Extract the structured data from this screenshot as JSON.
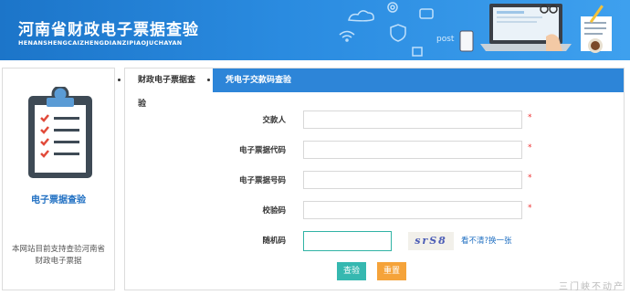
{
  "header": {
    "title": "河南省财政电子票据查验",
    "subtitle": "HENANSHENGCAIZHENGDIANZIPIAOJUCHAYAN",
    "deco_word": "post"
  },
  "sidebar": {
    "title": "电子票据查验",
    "note": "本网站目前支持查验河南省财政电子票据",
    "icon": "clipboard-checklist-icon"
  },
  "tabs": [
    {
      "label": "财政电子票据查验",
      "active": true
    },
    {
      "label": "凭电子交款码查验",
      "active": false
    }
  ],
  "form": {
    "fields": [
      {
        "label": "交款人",
        "value": "",
        "required_mark": "*"
      },
      {
        "label": "电子票据代码",
        "value": "",
        "required_mark": "*"
      },
      {
        "label": "电子票据号码",
        "value": "",
        "required_mark": "*"
      },
      {
        "label": "校验码",
        "value": "",
        "required_mark": "*"
      }
    ],
    "captcha": {
      "label": "随机码",
      "value": "",
      "image_text": "srS8",
      "refresh_label": "看不清?换一张"
    },
    "buttons": {
      "query": "查验",
      "reset": "重置"
    }
  },
  "watermark": "三门峡不动产",
  "colors": {
    "header_blue": "#2a8be0",
    "tab_blue": "#2d85d8",
    "query_button": "#36b8b0",
    "reset_button": "#f5a33a",
    "required": "#ee3333",
    "sidebar_title": "#1f6fc2"
  }
}
